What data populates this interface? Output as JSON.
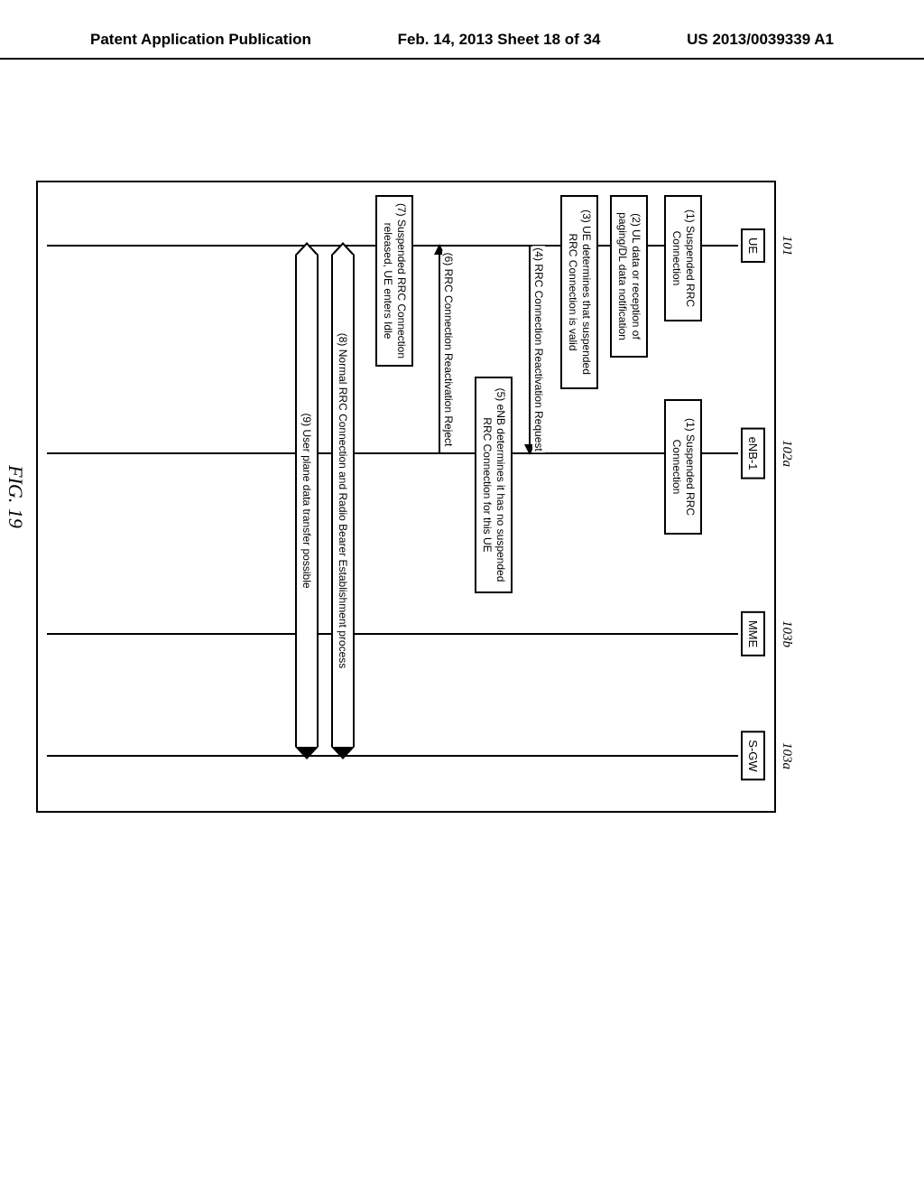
{
  "header": {
    "left": "Patent Application Publication",
    "center": "Feb. 14, 2013  Sheet 18 of 34",
    "right": "US 2013/0039339 A1"
  },
  "actors": {
    "ue": {
      "id": "101",
      "label": "UE"
    },
    "enb": {
      "id": "102a",
      "label": "eNB-1"
    },
    "mme": {
      "id": "103b",
      "label": "MME"
    },
    "sgw": {
      "id": "103a",
      "label": "S-GW"
    }
  },
  "steps": {
    "s1a": "(1) Suspended RRC Connection",
    "s1b": "(1) Suspended RRC Connection",
    "s2": "(2) UL data or reception of paging/DL data notification",
    "s3": "(3) UE determines that suspended RRC Connection is valid",
    "s4": "(4) RRC Connection Reactivation Request",
    "s5": "(5) eNB determines it has no suspended RRC Connection for this UE",
    "s6": "(6) RRC Connection Reactivation Reject",
    "s7": "(7) Suspended RRC Connection released, UE enters Idle",
    "s8": "(8) Normal RRC Connection and Radio Bearer Establishment process",
    "s9": "(9) User plane data transfer possible"
  },
  "fig_caption": "FIG. 19"
}
